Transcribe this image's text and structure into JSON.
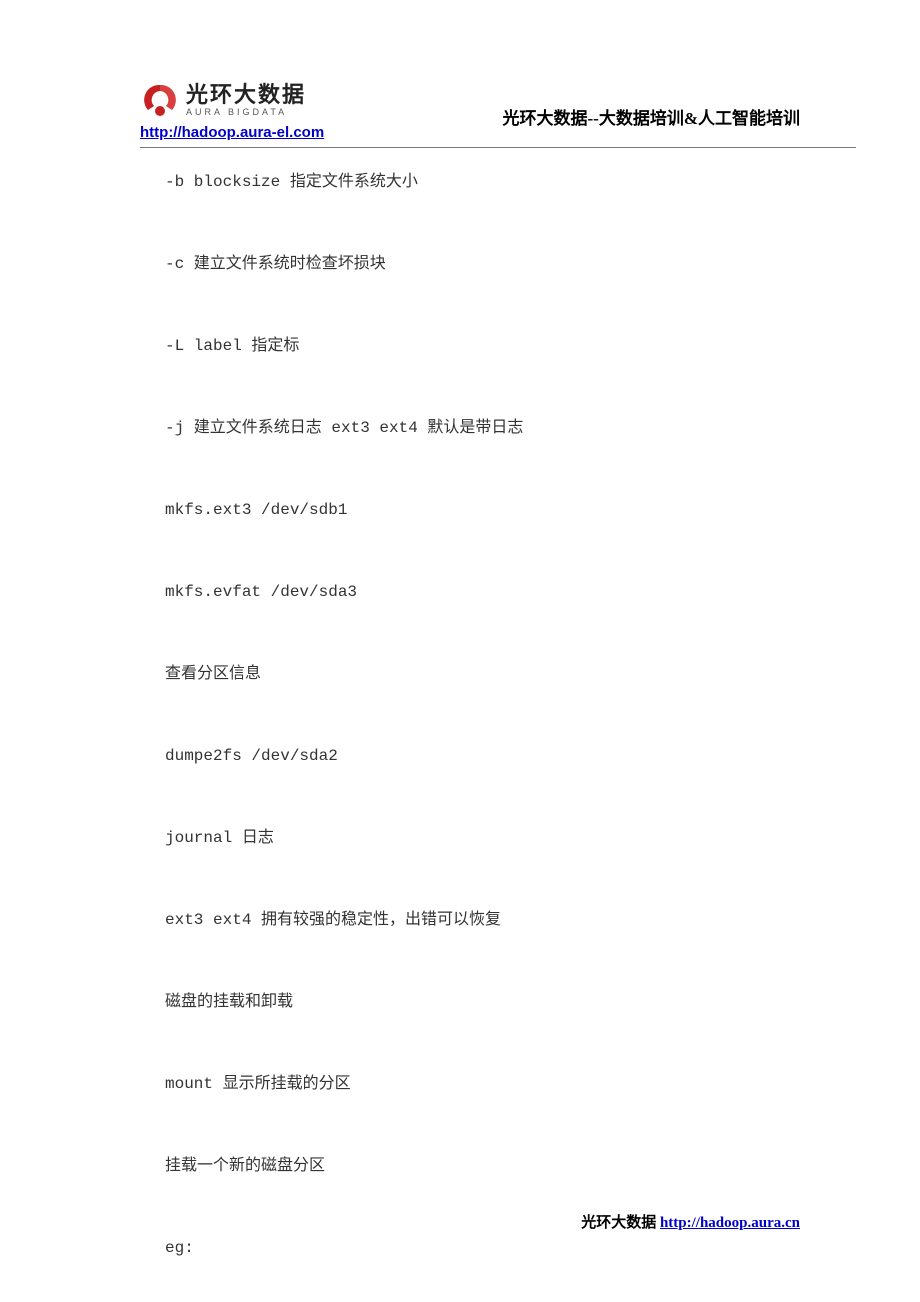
{
  "header": {
    "logo_cn": "光环大数据",
    "logo_en": "AURA   BIGDATA",
    "title": "光环大数据--大数据培训&人工智能培训",
    "url": "http://hadoop.aura-el.com"
  },
  "content": {
    "lines": [
      "-b blocksize 指定文件系统大小",
      "-c 建立文件系统时检查坏损块",
      "-L label 指定标",
      "-j 建立文件系统日志 ext3 ext4 默认是带日志",
      "mkfs.ext3 /dev/sdb1",
      "mkfs.evfat /dev/sda3",
      "查看分区信息",
      "dumpe2fs /dev/sda2",
      "journal 日志",
      "ext3 ext4 拥有较强的稳定性，出错可以恢复",
      "磁盘的挂载和卸载",
      "mount 显示所挂载的分区",
      "挂载一个新的磁盘分区",
      "eg:"
    ]
  },
  "footer": {
    "prefix": "光环大数据 ",
    "url": "http://hadoop.aura.cn"
  }
}
